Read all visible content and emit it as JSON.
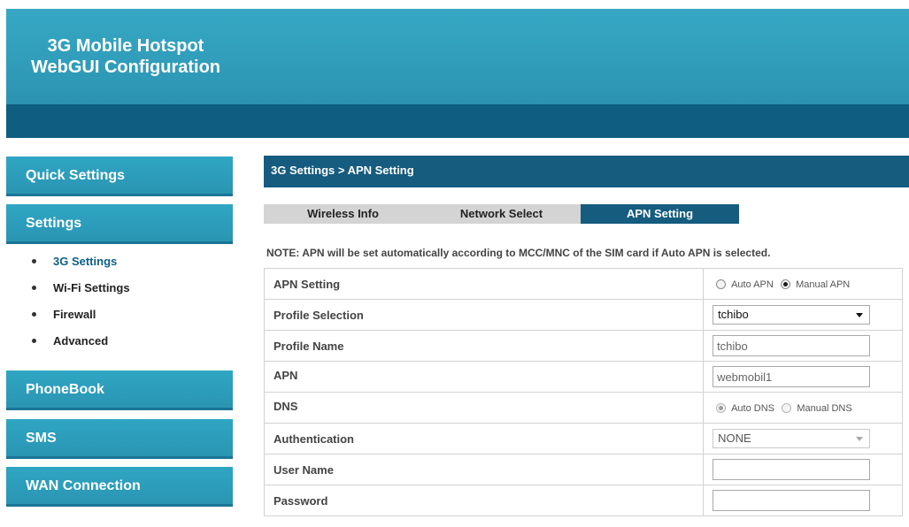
{
  "header": {
    "title_line1": "3G Mobile Hotspot",
    "title_line2": "WebGUI Configuration"
  },
  "sidebar": {
    "quick_settings": "Quick Settings",
    "settings": "Settings",
    "sub_items": [
      "3G Settings",
      "Wi-Fi Settings",
      "Firewall",
      "Advanced"
    ],
    "phonebook": "PhoneBook",
    "sms": "SMS",
    "wan_connection": "WAN Connection"
  },
  "breadcrumb": "3G Settings > APN Setting",
  "tabs": [
    "Wireless Info",
    "Network Select",
    "APN Setting"
  ],
  "active_tab": "APN Setting",
  "note": "NOTE: APN will be set automatically according to MCC/MNC of the SIM card if Auto APN is selected.",
  "form": {
    "apn_setting": {
      "label": "APN Setting",
      "opt_auto": "Auto APN",
      "opt_manual": "Manual APN",
      "selected": "Manual APN"
    },
    "profile_selection": {
      "label": "Profile Selection",
      "value": "tchibo"
    },
    "profile_name": {
      "label": "Profile Name",
      "value": "tchibo"
    },
    "apn": {
      "label": "APN",
      "value": "webmobil1"
    },
    "dns": {
      "label": "DNS",
      "opt_auto": "Auto DNS",
      "opt_manual": "Manual DNS",
      "selected": "Auto DNS"
    },
    "authentication": {
      "label": "Authentication",
      "value": "NONE"
    },
    "user_name": {
      "label": "User Name",
      "value": ""
    },
    "password": {
      "label": "Password",
      "value": ""
    }
  },
  "colors": {
    "header": "#2e98b6",
    "band": "#0f5d80",
    "sidebar_button": "#2a95b3",
    "active_tab": "#155c7f",
    "active_subitem": "#0d5f86"
  }
}
